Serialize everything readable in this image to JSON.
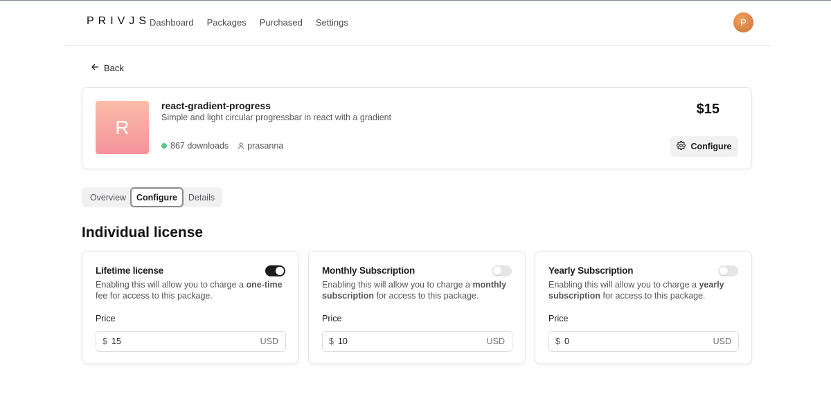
{
  "header": {
    "logo": "PRIVJS",
    "nav": [
      "Dashboard",
      "Packages",
      "Purchased",
      "Settings"
    ],
    "avatar_initial": "P"
  },
  "back_label": "Back",
  "package": {
    "initial": "R",
    "name": "react-gradient-progress",
    "description": "Simple and light circular progressbar in react with a gradient",
    "downloads": "867 downloads",
    "author": "prasanna",
    "price": "$15",
    "configure_label": "Configure"
  },
  "tabs": [
    "Overview",
    "Configure",
    "Details"
  ],
  "active_tab": "Configure",
  "section_title": "Individual license",
  "licenses": [
    {
      "title": "Lifetime license",
      "desc_prefix": "Enabling this will allow you to charge a ",
      "desc_bold": "one-time",
      "desc_suffix": " fee for access to this package.",
      "enabled": true,
      "price_label": "Price",
      "currency_symbol": "$",
      "price": "15",
      "currency": "USD"
    },
    {
      "title": "Monthly Subscription",
      "desc_prefix": "Enabling this will allow you to charge a ",
      "desc_bold": "monthly subscription",
      "desc_suffix": " for access to this package.",
      "enabled": false,
      "price_label": "Price",
      "currency_symbol": "$",
      "price": "10",
      "currency": "USD"
    },
    {
      "title": "Yearly Subscription",
      "desc_prefix": "Enabling this will allow you to charge a ",
      "desc_bold": "yearly subscription",
      "desc_suffix": " for access to this package.",
      "enabled": false,
      "price_label": "Price",
      "currency_symbol": "$",
      "price": "0",
      "currency": "USD"
    }
  ],
  "colors": {
    "downloads_dot": "#5cc98a",
    "toggle_on": "#1c1c1e",
    "thumb_gradient_top": "#fbbda9",
    "thumb_gradient_bottom": "#f3939a",
    "avatar": "#d9823f"
  },
  "icons": {
    "back": "arrow-left-icon",
    "downloads": "status-dot-icon",
    "author": "user-icon",
    "configure": "gear-icon"
  }
}
